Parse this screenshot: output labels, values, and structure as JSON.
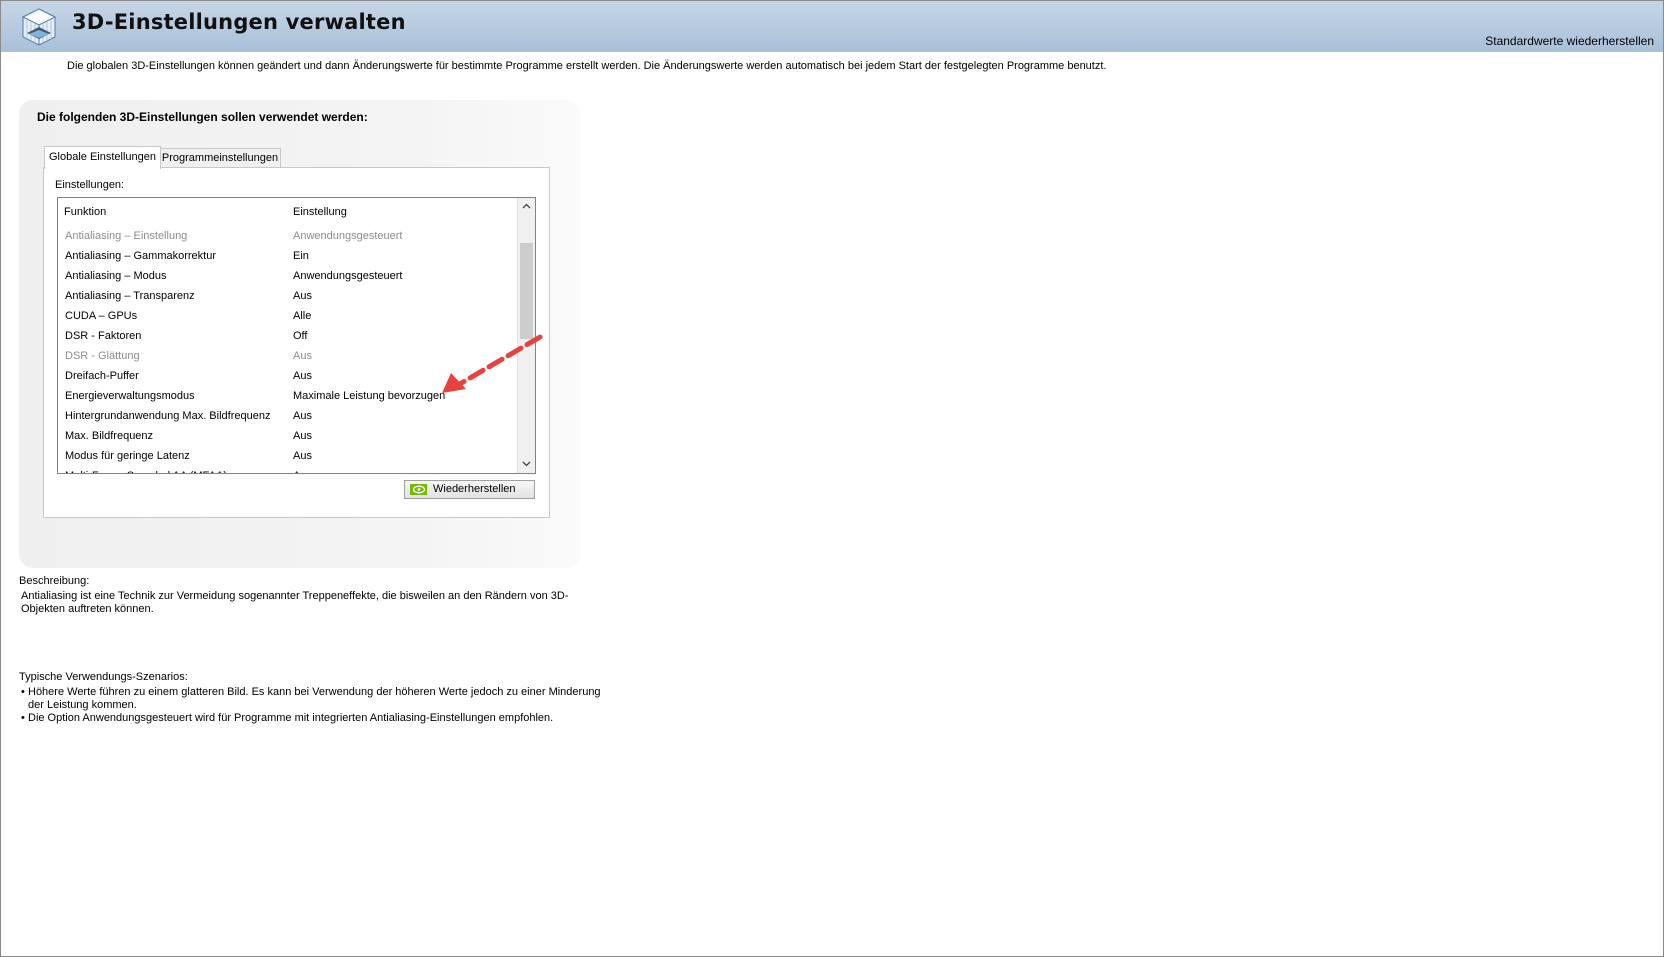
{
  "header": {
    "title": "3D-Einstellungen verwalten",
    "restore_defaults_label": "Standardwerte wiederherstellen",
    "icon": "3d-cube-icon"
  },
  "intro": "Die globalen 3D-Einstellungen können geändert und dann Änderungswerte für bestimmte Programme erstellt werden. Die Änderungswerte werden automatisch bei jedem Start der festgelegten Programme benutzt.",
  "group": {
    "title": "Die folgenden 3D-Einstellungen sollen verwendet werden:",
    "tabs": [
      {
        "label": "Globale Einstellungen",
        "active": true
      },
      {
        "label": "Programmeinstellungen",
        "active": false
      }
    ],
    "settings_label": "Einstellungen:",
    "columns": {
      "function": "Funktion",
      "setting": "Einstellung"
    },
    "rows": [
      {
        "function": "Antialiasing – Einstellung",
        "setting": "Anwendungsgesteuert",
        "disabled": true
      },
      {
        "function": "Antialiasing – Gammakorrektur",
        "setting": "Ein",
        "disabled": false
      },
      {
        "function": "Antialiasing – Modus",
        "setting": "Anwendungsgesteuert",
        "disabled": false
      },
      {
        "function": "Antialiasing – Transparenz",
        "setting": "Aus",
        "disabled": false
      },
      {
        "function": "CUDA – GPUs",
        "setting": "Alle",
        "disabled": false
      },
      {
        "function": "DSR - Faktoren",
        "setting": "Off",
        "disabled": false
      },
      {
        "function": "DSR - Glättung",
        "setting": "Aus",
        "disabled": true
      },
      {
        "function": "Dreifach-Puffer",
        "setting": "Aus",
        "disabled": false
      },
      {
        "function": "Energieverwaltungsmodus",
        "setting": "Maximale Leistung bevorzugen",
        "disabled": false
      },
      {
        "function": "Hintergrundanwendung Max. Bildfrequenz",
        "setting": "Aus",
        "disabled": false
      },
      {
        "function": "Max. Bildfrequenz",
        "setting": "Aus",
        "disabled": false
      },
      {
        "function": "Modus für geringe Latenz",
        "setting": "Aus",
        "disabled": false
      },
      {
        "function": "Multi-Frame Sampled AA (MFAA)",
        "setting": "Aus",
        "disabled": false
      }
    ],
    "restore_button_label": "Wiederherstellen",
    "annotation_color": "#e8423f"
  },
  "description": {
    "label": "Beschreibung:",
    "text": "Antialiasing ist eine Technik zur Vermeidung sogenannter Treppeneffekte, die bisweilen an den Rändern von 3D-Objekten auftreten können."
  },
  "usage": {
    "label": "Typische Verwendungs-Szenarios:",
    "items": [
      "Höhere Werte führen zu einem glatteren Bild. Es kann bei Verwendung der höheren Werte jedoch zu einer Minderung der Leistung kommen.",
      "Die Option Anwendungsgesteuert wird für Programme mit integrierten Antialiasing-Einstellungen empfohlen."
    ]
  }
}
